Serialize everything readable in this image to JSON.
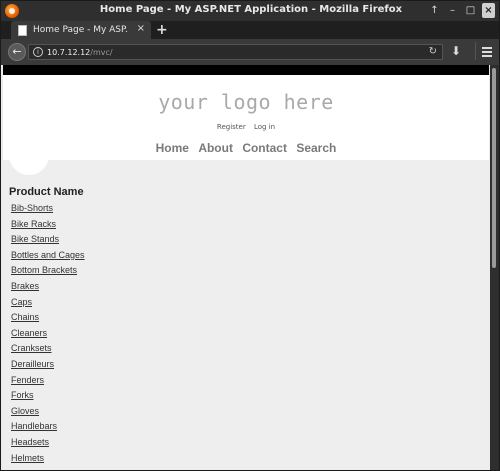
{
  "window": {
    "title": "Home Page - My ASP.NET Application - Mozilla Firefox",
    "controls": [
      "↑",
      "–",
      "□",
      "×"
    ]
  },
  "tab": {
    "label": "Home Page - My ASP.",
    "close": "×",
    "new_tab": "+"
  },
  "urlbar": {
    "host": "10.7.12.12",
    "path": "/mvc/"
  },
  "page": {
    "logo": "your logo here",
    "login_links": [
      "Register",
      "Log in"
    ],
    "nav": [
      "Home",
      "About",
      "Contact",
      "Search"
    ],
    "section_title": "Product Name",
    "products": [
      "Bib-Shorts",
      "Bike Racks",
      "Bike Stands",
      "Bottles and Cages",
      "Bottom Brackets",
      "Brakes",
      "Caps",
      "Chains",
      "Cleaners",
      "Cranksets",
      "Derailleurs",
      "Fenders",
      "Forks",
      "Gloves",
      "Handlebars",
      "Headsets",
      "Helmets"
    ]
  }
}
